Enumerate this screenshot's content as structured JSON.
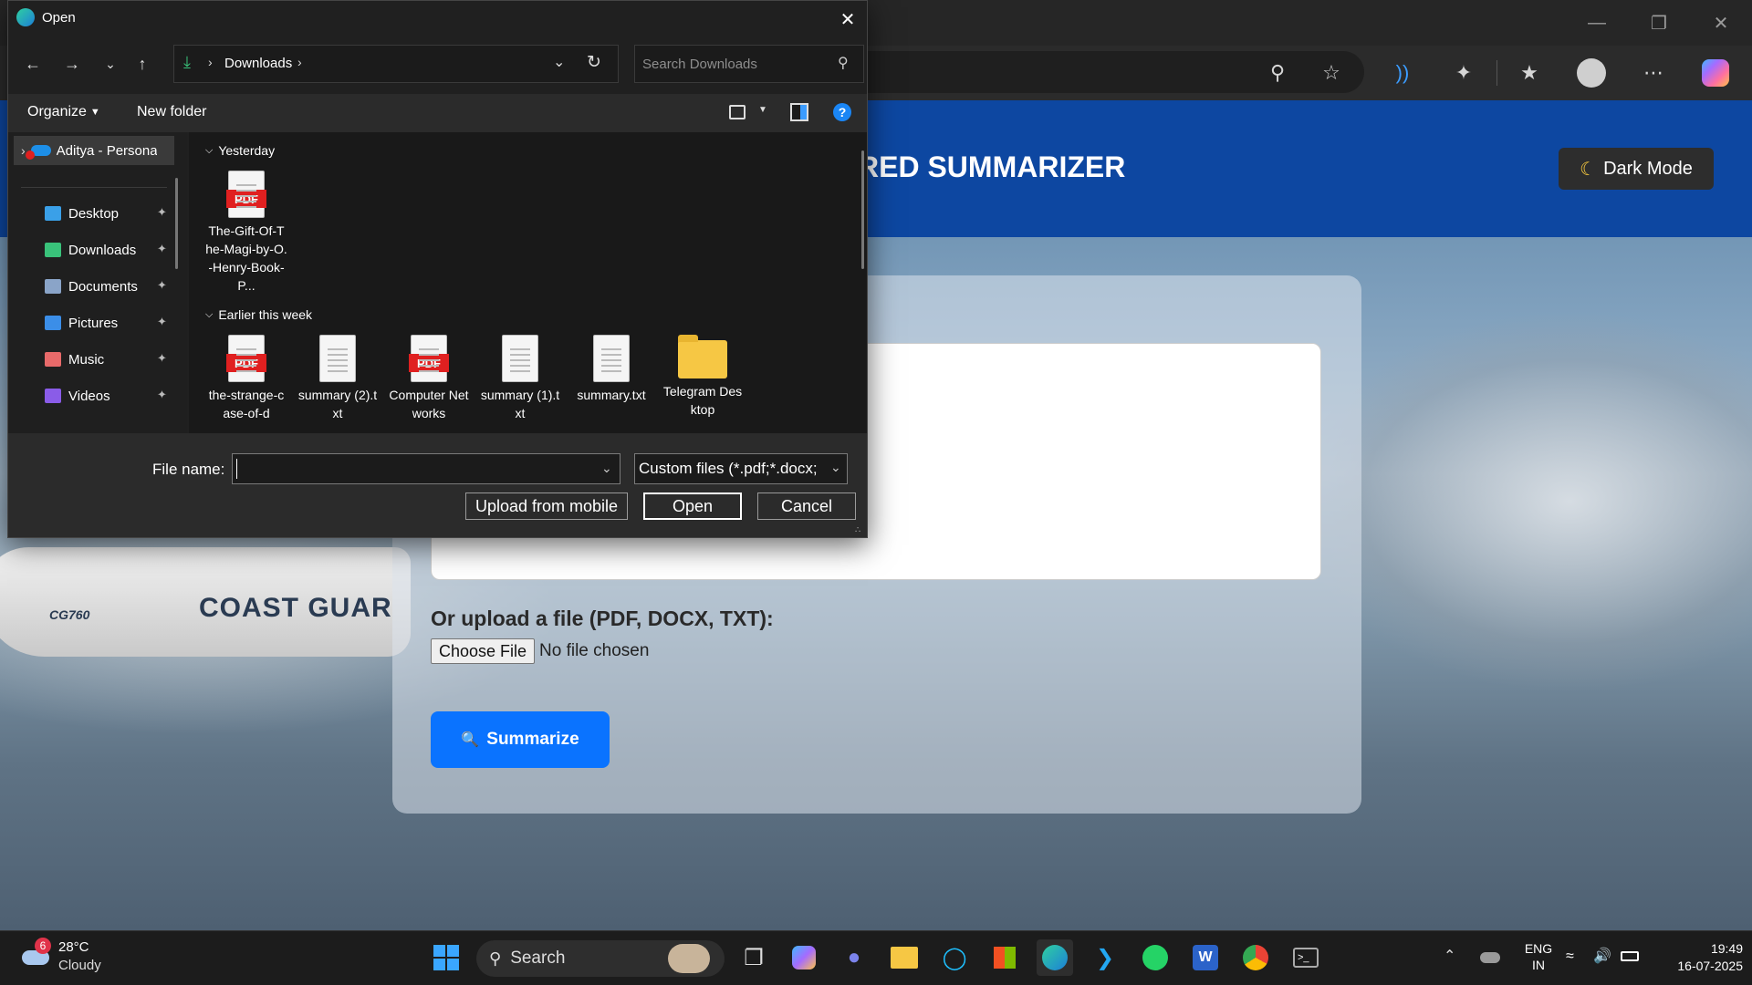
{
  "dialog": {
    "title": "Open",
    "path_segment": "Downloads",
    "search_placeholder": "Search Downloads",
    "organize_label": "Organize",
    "new_folder_label": "New folder",
    "nav": {
      "onedrive_label": "Aditya - Persona",
      "items": [
        {
          "label": "Desktop",
          "icon": "desktop-icon",
          "color": "#3aa0e8"
        },
        {
          "label": "Downloads",
          "icon": "download-icon",
          "color": "#39c27a"
        },
        {
          "label": "Documents",
          "icon": "documents-icon",
          "color": "#8aa4c8"
        },
        {
          "label": "Pictures",
          "icon": "pictures-icon",
          "color": "#3b8ee8"
        },
        {
          "label": "Music",
          "icon": "music-icon",
          "color": "#e86a6a"
        },
        {
          "label": "Videos",
          "icon": "videos-icon",
          "color": "#8a5ce8"
        }
      ]
    },
    "groups": [
      {
        "label": "Yesterday",
        "files": [
          {
            "name": "The-Gift-Of-The-Magi-by-O.-Henry-Book-P...",
            "type": "pdf"
          }
        ]
      },
      {
        "label": "Earlier this week",
        "files": [
          {
            "name": "the-strange-case-of-d",
            "type": "pdf"
          },
          {
            "name": "summary (2).txt",
            "type": "txt"
          },
          {
            "name": "Computer Networks",
            "type": "pdf"
          },
          {
            "name": "summary (1).txt",
            "type": "txt"
          },
          {
            "name": "summary.txt",
            "type": "txt"
          },
          {
            "name": "Telegram Desktop",
            "type": "folder"
          }
        ]
      }
    ],
    "file_name_label": "File name:",
    "file_name_value": "",
    "file_type": "Custom files (*.pdf;*.docx;",
    "upload_mobile_label": "Upload from mobile",
    "open_label": "Open",
    "cancel_label": "Cancel",
    "pdf_badge": "PDF"
  },
  "webpage": {
    "title": "RED SUMMARIZER",
    "dark_mode_label": "Dark Mode",
    "upload_label": "Or upload a file (PDF, DOCX, TXT):",
    "choose_file_label": "Choose File",
    "no_file_text": "No file chosen",
    "summarize_label": "Summarize",
    "plane_text": "COAST GUAR",
    "plane_reg": "CG760"
  },
  "taskbar": {
    "weather_temp": "28°C",
    "weather_desc": "Cloudy",
    "weather_badge": "6",
    "search_label": "Search",
    "lang_top": "ENG",
    "lang_bottom": "IN",
    "time": "19:49",
    "date": "16-07-2025"
  },
  "colors": {
    "site_header": "#0d47a1",
    "summarize_button": "#0a73ff",
    "pdf_red": "#e02020"
  }
}
